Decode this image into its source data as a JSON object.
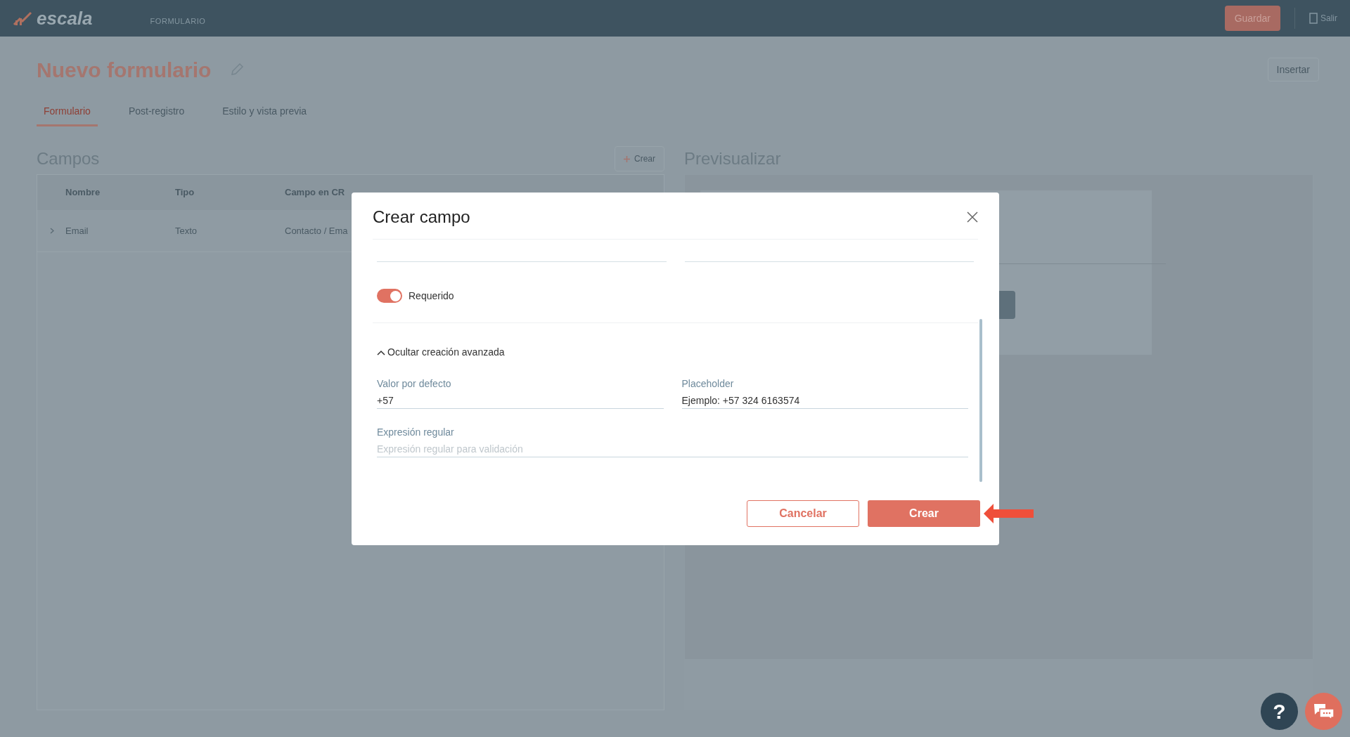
{
  "top_bar": {
    "logo": "escala",
    "section": "FORMULARIO",
    "save_button": "Guardar",
    "exit_button": "Salir"
  },
  "page": {
    "title": "Nuevo formulario",
    "insert_button": "Insertar",
    "tabs": [
      {
        "label": "Formulario",
        "selected": true
      },
      {
        "label": "Post-registro",
        "selected": false
      },
      {
        "label": "Estilo y vista previa",
        "selected": false
      }
    ],
    "fields_panel": {
      "title": "Campos",
      "create_button": "Crear",
      "table": {
        "columns": [
          "Nombre",
          "Tipo",
          "Campo en CR"
        ],
        "rows": [
          {
            "cells": [
              "Email",
              "Texto",
              "Contacto / Ema"
            ]
          }
        ]
      }
    },
    "preview": {
      "title": "Previsualizar"
    }
  },
  "modal": {
    "title": "Crear campo",
    "required_toggle": {
      "label": "Requerido",
      "on": true
    },
    "advanced_toggle": {
      "label": "Ocultar creación avanzada",
      "expanded": true
    },
    "fields": [
      {
        "label": "Valor por defecto",
        "value": "+57"
      },
      {
        "label": "Placeholder",
        "value": "Ejemplo: +57 324 6163574"
      },
      {
        "label": "Expresión regular",
        "placeholder": "Expresión regular para validación"
      }
    ],
    "cancel_button": "Cancelar",
    "create_button": "Crear"
  },
  "help_button": "?"
}
